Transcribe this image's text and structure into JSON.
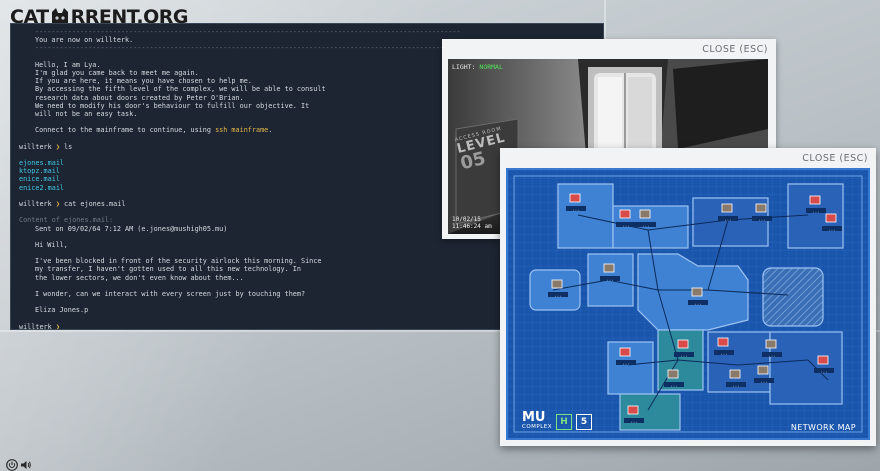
{
  "site": {
    "logo_text_left": "CAT",
    "logo_text_right": "RRENT.ORG"
  },
  "terminal": {
    "lines": [
      {
        "text": "--------------------------------------------------------------------------------------------------------",
        "cls": "t-dim t-indent"
      },
      {
        "text": "You are now on willterk.",
        "cls": "t-indent"
      },
      {
        "text": "--------------------------------------------------------------------------------------------------------",
        "cls": "t-dim t-indent"
      },
      {
        "text": "",
        "cls": "blank"
      },
      {
        "text": "Hello, I am Lya.",
        "cls": "t-indent"
      },
      {
        "text": "I'm glad you came back to meet me again.",
        "cls": "t-indent"
      },
      {
        "text": "If you are here, it means you have chosen to help me.",
        "cls": "t-indent"
      },
      {
        "text": "By accessing the fifth level of the complex, we will be able to consult",
        "cls": "t-indent"
      },
      {
        "text": "research data about doors created by Peter O'Brian.",
        "cls": "t-indent"
      },
      {
        "text": "We need to modify his door's behaviour to fulfill our objective. It",
        "cls": "t-indent"
      },
      {
        "text": "will not be an easy task.",
        "cls": "t-indent"
      },
      {
        "text": "",
        "cls": "blank"
      },
      {
        "text": "Connect to the mainframe to continue, using ",
        "cls": "t-indent",
        "highlight": "ssh mainframe",
        "after": "."
      },
      {
        "text": "",
        "cls": "blank"
      },
      {
        "text": "willterk",
        "cls": "",
        "prompt": true,
        "cmd": "ls"
      },
      {
        "text": "",
        "cls": "blank"
      },
      {
        "text": "ejones.mail",
        "cls": "t-cyan"
      },
      {
        "text": "ktopz.mail",
        "cls": "t-cyan"
      },
      {
        "text": "enice.mail",
        "cls": "t-cyan"
      },
      {
        "text": "enice2.mail",
        "cls": "t-cyan"
      },
      {
        "text": "",
        "cls": "blank"
      },
      {
        "text": "willterk",
        "cls": "",
        "prompt": true,
        "cmd": "cat ejones.mail"
      },
      {
        "text": "",
        "cls": "blank"
      },
      {
        "text": "Content of ejones.mail:",
        "cls": "t-dim"
      },
      {
        "text": "Sent on 09/02/64 7:12 AM (e.jones@mushigh05.mu)",
        "cls": "t-indent"
      },
      {
        "text": "",
        "cls": "blank"
      },
      {
        "text": "Hi Will,",
        "cls": "t-indent"
      },
      {
        "text": "",
        "cls": "blank"
      },
      {
        "text": "I've been blocked in front of the security airlock this morning. Since",
        "cls": "t-indent"
      },
      {
        "text": "my transfer, I haven't gotten used to all this new technology. In",
        "cls": "t-indent"
      },
      {
        "text": "the lower sectors, we don't even know about them...",
        "cls": "t-indent"
      },
      {
        "text": "",
        "cls": "blank"
      },
      {
        "text": "I wonder, can we interact with every screen just by touching them?",
        "cls": "t-indent"
      },
      {
        "text": "",
        "cls": "blank"
      },
      {
        "text": "Eliza Jones.p",
        "cls": "t-indent"
      },
      {
        "text": "",
        "cls": "blank"
      },
      {
        "text": "willterk",
        "cls": "",
        "prompt": true,
        "cmd": ""
      }
    ]
  },
  "camera_panel": {
    "close_label": "CLOSE (ESC)",
    "light_label": "LIGHT:",
    "light_status": "NORMAL",
    "wall_sign_top": "ACCESS ROOM",
    "wall_sign_level": "LEVEL",
    "wall_sign_number": "05",
    "timestamp_date": "10/02/15",
    "timestamp_time": "11:46:24 am"
  },
  "map_panel": {
    "close_label": "CLOSE (ESC)",
    "title": "NETWORK MAP",
    "brand_logo": "MU",
    "brand_sub": "COMPLEX",
    "badge_h": "H",
    "badge_level": "5",
    "node_label": "...",
    "colors": {
      "background": "#1b56ad",
      "room": "#3f82d3",
      "room_dark": "#2a62b8",
      "teal": "#2c8a9c",
      "node": "#d94b4b"
    }
  },
  "controls": {
    "power_icon": "power-icon",
    "sound_icon": "speaker-icon"
  }
}
